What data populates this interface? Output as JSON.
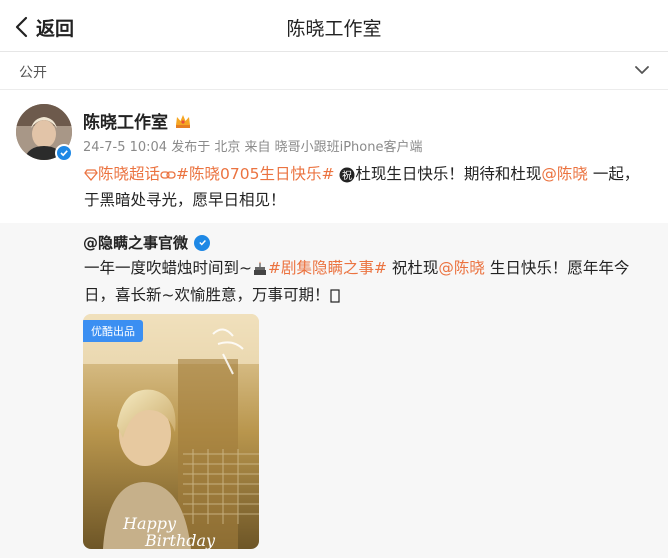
{
  "header": {
    "back_label": "返回",
    "title": "陈晓工作室"
  },
  "visibility": {
    "label": "公开"
  },
  "post": {
    "author": "陈晓工作室",
    "meta": "24-7-5 10:04 发布于 北京 来自 晓哥小跟班iPhone客户端",
    "tag_super": "陈晓超话",
    "tag_birthday": "#陈晓0705生日快乐#",
    "text_1": "杜现生日快乐！期待和杜现",
    "mention": "@陈晓",
    "text_2": " 一起，于黑暗处寻光，愿早日相见！"
  },
  "repost": {
    "author": "@隐瞒之事官微",
    "text_1": "一年一度吹蜡烛时间到~",
    "tag_drama": "#剧集隐瞒之事#",
    "text_2": " 祝杜现",
    "mention": "@陈晓",
    "text_3": " 生日快乐！愿年年今日，喜长新~欢愉胜意，万事可期！",
    "image_badge": "优酷出品"
  }
}
